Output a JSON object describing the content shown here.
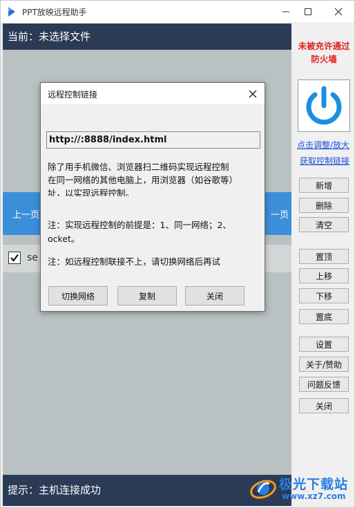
{
  "window": {
    "title": "PPT放映远程助手"
  },
  "main": {
    "current_label": "当前：未选择文件",
    "prev_page": "上一页",
    "next_page": "一页",
    "file_item": "se",
    "status": "提示：主机连接成功"
  },
  "sidebar": {
    "warning": "未被充许通过防火墙",
    "link_adjust": "点击调整/放大",
    "link_get": "获取控制链接",
    "buttons": {
      "add": "新增",
      "delete": "删除",
      "clear": "清空",
      "top": "置顶",
      "up": "上移",
      "down": "下移",
      "bottom": "置底",
      "settings": "设置",
      "about": "关于/赞助",
      "feedback": "问题反馈",
      "close": "关闭"
    }
  },
  "dialog": {
    "title": "远程控制链接",
    "url": "http://:8888/index.html",
    "para_line1": "除了用手机微信、浏览器扫二维码实现远程控制",
    "para_line2": "在同一网络的其他电脑上，用浏览器（如谷歌等）",
    "para_line3": "址，以实现远程控制。",
    "note1_line1": "注：实现远程控制的前提是：1、同一网络；2、",
    "note1_line2": "ocket。",
    "note2": "注：如远程控制联接不上，请切换网络后再试",
    "btn_switch": "切换网络",
    "btn_copy": "复制",
    "btn_close": "关闭"
  },
  "watermark": {
    "title": "极光下载站",
    "url": "www.xz7.com"
  },
  "colors": {
    "header_bg": "#2b3a55",
    "nav_bg": "#3b8fd9",
    "preview_bg": "#b9c1c3",
    "warning": "#e02020",
    "power_icon": "#1a8fe0",
    "link": "#1a4fd6"
  }
}
